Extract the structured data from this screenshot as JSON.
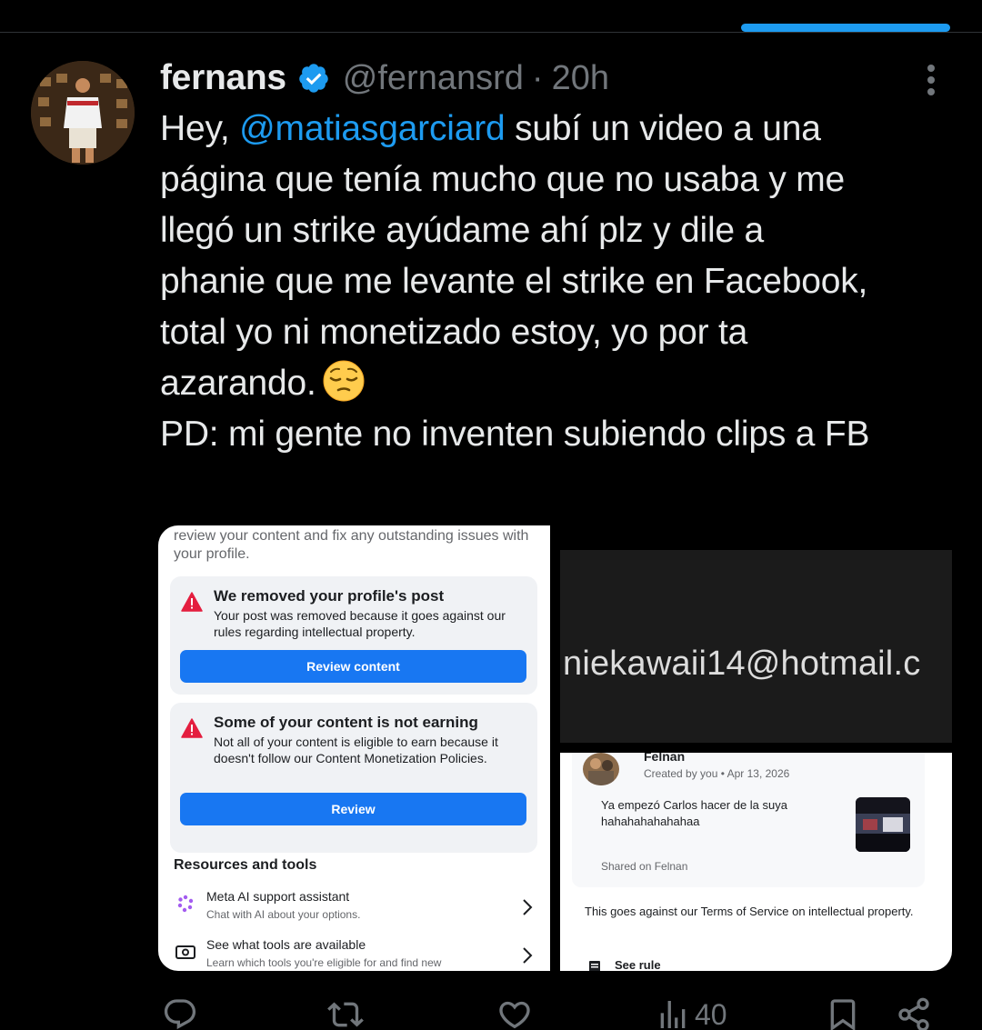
{
  "colors": {
    "accent": "#1d9bf0",
    "background": "#000000",
    "text": "#e7e9ea",
    "muted": "#71767b",
    "fb_blue": "#1877f2"
  },
  "tweet": {
    "author": {
      "name": "fernans",
      "handle": "@fernansrd",
      "verified": true
    },
    "separator": "·",
    "time": "20h",
    "text_lines": [
      {
        "pre": "Hey, ",
        "mention": "@matiasgarciard",
        "post": " subí un video a una"
      },
      "página que tenía mucho que no usaba y me",
      "llegó un strike ayúdame ahí plz y dile a",
      "phanie que me levante el strike en Facebook,",
      "total yo ni monetizado estoy, yo por ta",
      "azarando.",
      "PD: mi gente no inventen subiendo clips a FB"
    ],
    "emoji": "pensive-face"
  },
  "media": {
    "left": {
      "intro": "review your content and fix any outstanding issues with your profile.",
      "card1": {
        "title": "We removed your profile's post",
        "body": "Your post was removed because it goes against our rules regarding intellectual property.",
        "button": "Review content"
      },
      "card2": {
        "title": "Some of your content is not earning",
        "body": "Not all of your content is eligible to earn because it doesn't follow our Content Monetization Policies.",
        "button": "Review"
      },
      "resources_heading": "Resources and tools",
      "resources": [
        {
          "title": "Meta AI support assistant",
          "subtitle": "Chat with AI about your options.",
          "icon": "meta-ai-icon"
        },
        {
          "title": "See what tools are available",
          "subtitle": "Learn which tools you're eligible for and find new",
          "icon": "money-icon"
        }
      ]
    },
    "right_top": {
      "email_fragment": "niekawaii14@hotmail.c"
    },
    "right_bottom": {
      "post_name": "Felnan",
      "post_meta": "Created by you • Apr 13, 2026",
      "post_text": "Ya empezó Carlos hacer de la suya hahahahahahahaa",
      "shared_on": "Shared on Felnan",
      "tos": "This goes against our Terms of Service on intellectual property.",
      "bottom_label": "See rule"
    }
  },
  "actions": {
    "reply_icon": "reply-icon",
    "retweet_icon": "retweet-icon",
    "like_icon": "heart-icon",
    "views_count": "40",
    "bookmark_icon": "bookmark-icon",
    "share_icon": "share-icon"
  }
}
